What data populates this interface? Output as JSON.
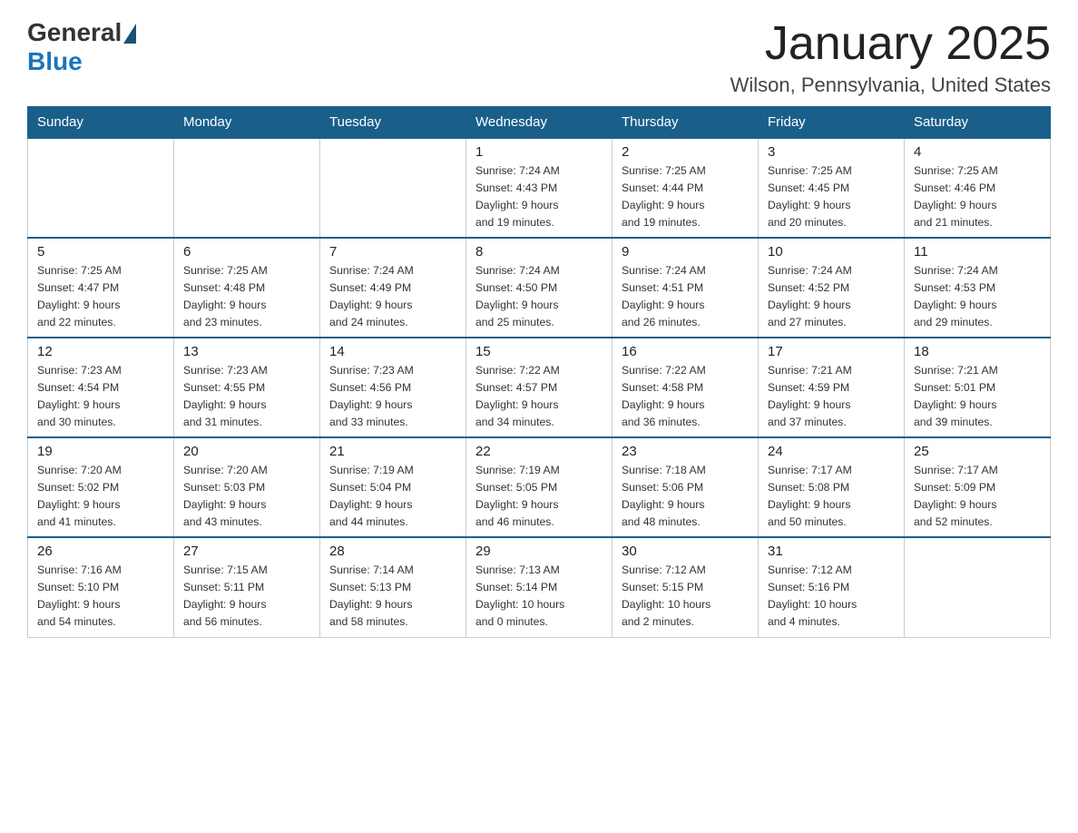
{
  "logo": {
    "text_general": "General",
    "text_blue": "Blue"
  },
  "header": {
    "month": "January 2025",
    "location": "Wilson, Pennsylvania, United States"
  },
  "days_of_week": [
    "Sunday",
    "Monday",
    "Tuesday",
    "Wednesday",
    "Thursday",
    "Friday",
    "Saturday"
  ],
  "weeks": [
    [
      {
        "day": "",
        "info": ""
      },
      {
        "day": "",
        "info": ""
      },
      {
        "day": "",
        "info": ""
      },
      {
        "day": "1",
        "info": "Sunrise: 7:24 AM\nSunset: 4:43 PM\nDaylight: 9 hours\nand 19 minutes."
      },
      {
        "day": "2",
        "info": "Sunrise: 7:25 AM\nSunset: 4:44 PM\nDaylight: 9 hours\nand 19 minutes."
      },
      {
        "day": "3",
        "info": "Sunrise: 7:25 AM\nSunset: 4:45 PM\nDaylight: 9 hours\nand 20 minutes."
      },
      {
        "day": "4",
        "info": "Sunrise: 7:25 AM\nSunset: 4:46 PM\nDaylight: 9 hours\nand 21 minutes."
      }
    ],
    [
      {
        "day": "5",
        "info": "Sunrise: 7:25 AM\nSunset: 4:47 PM\nDaylight: 9 hours\nand 22 minutes."
      },
      {
        "day": "6",
        "info": "Sunrise: 7:25 AM\nSunset: 4:48 PM\nDaylight: 9 hours\nand 23 minutes."
      },
      {
        "day": "7",
        "info": "Sunrise: 7:24 AM\nSunset: 4:49 PM\nDaylight: 9 hours\nand 24 minutes."
      },
      {
        "day": "8",
        "info": "Sunrise: 7:24 AM\nSunset: 4:50 PM\nDaylight: 9 hours\nand 25 minutes."
      },
      {
        "day": "9",
        "info": "Sunrise: 7:24 AM\nSunset: 4:51 PM\nDaylight: 9 hours\nand 26 minutes."
      },
      {
        "day": "10",
        "info": "Sunrise: 7:24 AM\nSunset: 4:52 PM\nDaylight: 9 hours\nand 27 minutes."
      },
      {
        "day": "11",
        "info": "Sunrise: 7:24 AM\nSunset: 4:53 PM\nDaylight: 9 hours\nand 29 minutes."
      }
    ],
    [
      {
        "day": "12",
        "info": "Sunrise: 7:23 AM\nSunset: 4:54 PM\nDaylight: 9 hours\nand 30 minutes."
      },
      {
        "day": "13",
        "info": "Sunrise: 7:23 AM\nSunset: 4:55 PM\nDaylight: 9 hours\nand 31 minutes."
      },
      {
        "day": "14",
        "info": "Sunrise: 7:23 AM\nSunset: 4:56 PM\nDaylight: 9 hours\nand 33 minutes."
      },
      {
        "day": "15",
        "info": "Sunrise: 7:22 AM\nSunset: 4:57 PM\nDaylight: 9 hours\nand 34 minutes."
      },
      {
        "day": "16",
        "info": "Sunrise: 7:22 AM\nSunset: 4:58 PM\nDaylight: 9 hours\nand 36 minutes."
      },
      {
        "day": "17",
        "info": "Sunrise: 7:21 AM\nSunset: 4:59 PM\nDaylight: 9 hours\nand 37 minutes."
      },
      {
        "day": "18",
        "info": "Sunrise: 7:21 AM\nSunset: 5:01 PM\nDaylight: 9 hours\nand 39 minutes."
      }
    ],
    [
      {
        "day": "19",
        "info": "Sunrise: 7:20 AM\nSunset: 5:02 PM\nDaylight: 9 hours\nand 41 minutes."
      },
      {
        "day": "20",
        "info": "Sunrise: 7:20 AM\nSunset: 5:03 PM\nDaylight: 9 hours\nand 43 minutes."
      },
      {
        "day": "21",
        "info": "Sunrise: 7:19 AM\nSunset: 5:04 PM\nDaylight: 9 hours\nand 44 minutes."
      },
      {
        "day": "22",
        "info": "Sunrise: 7:19 AM\nSunset: 5:05 PM\nDaylight: 9 hours\nand 46 minutes."
      },
      {
        "day": "23",
        "info": "Sunrise: 7:18 AM\nSunset: 5:06 PM\nDaylight: 9 hours\nand 48 minutes."
      },
      {
        "day": "24",
        "info": "Sunrise: 7:17 AM\nSunset: 5:08 PM\nDaylight: 9 hours\nand 50 minutes."
      },
      {
        "day": "25",
        "info": "Sunrise: 7:17 AM\nSunset: 5:09 PM\nDaylight: 9 hours\nand 52 minutes."
      }
    ],
    [
      {
        "day": "26",
        "info": "Sunrise: 7:16 AM\nSunset: 5:10 PM\nDaylight: 9 hours\nand 54 minutes."
      },
      {
        "day": "27",
        "info": "Sunrise: 7:15 AM\nSunset: 5:11 PM\nDaylight: 9 hours\nand 56 minutes."
      },
      {
        "day": "28",
        "info": "Sunrise: 7:14 AM\nSunset: 5:13 PM\nDaylight: 9 hours\nand 58 minutes."
      },
      {
        "day": "29",
        "info": "Sunrise: 7:13 AM\nSunset: 5:14 PM\nDaylight: 10 hours\nand 0 minutes."
      },
      {
        "day": "30",
        "info": "Sunrise: 7:12 AM\nSunset: 5:15 PM\nDaylight: 10 hours\nand 2 minutes."
      },
      {
        "day": "31",
        "info": "Sunrise: 7:12 AM\nSunset: 5:16 PM\nDaylight: 10 hours\nand 4 minutes."
      },
      {
        "day": "",
        "info": ""
      }
    ]
  ]
}
